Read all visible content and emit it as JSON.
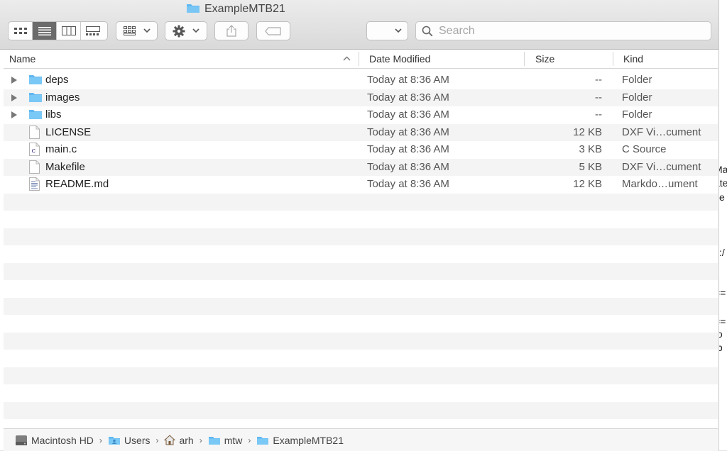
{
  "window": {
    "title": "ExampleMTB21"
  },
  "toolbar": {
    "view_modes": [
      "icon-view",
      "list-view",
      "column-view",
      "gallery-view"
    ],
    "active_view": "list-view",
    "search_placeholder": "Search"
  },
  "columns": {
    "name": "Name",
    "date": "Date Modified",
    "size": "Size",
    "kind": "Kind"
  },
  "files": [
    {
      "name": "deps",
      "date": "Today at 8:36 AM",
      "size": "--",
      "kind": "Folder",
      "type": "folder",
      "expandable": true
    },
    {
      "name": "images",
      "date": "Today at 8:36 AM",
      "size": "--",
      "kind": "Folder",
      "type": "folder",
      "expandable": true
    },
    {
      "name": "libs",
      "date": "Today at 8:36 AM",
      "size": "--",
      "kind": "Folder",
      "type": "folder",
      "expandable": true
    },
    {
      "name": "LICENSE",
      "date": "Today at 8:36 AM",
      "size": "12 KB",
      "kind": "DXF Vi…cument",
      "type": "document",
      "expandable": false
    },
    {
      "name": "main.c",
      "date": "Today at 8:36 AM",
      "size": "3 KB",
      "kind": "C Source",
      "type": "c-source",
      "expandable": false
    },
    {
      "name": "Makefile",
      "date": "Today at 8:36 AM",
      "size": "5 KB",
      "kind": "DXF Vi…cument",
      "type": "document",
      "expandable": false
    },
    {
      "name": "README.md",
      "date": "Today at 8:36 AM",
      "size": "12 KB",
      "kind": "Markdo…ument",
      "type": "text",
      "expandable": false
    }
  ],
  "pathbar": [
    {
      "label": "Macintosh HD",
      "icon": "hard-drive-icon"
    },
    {
      "label": "Users",
      "icon": "users-folder-icon"
    },
    {
      "label": "arh",
      "icon": "home-icon"
    },
    {
      "label": "mtw",
      "icon": "folder-icon"
    },
    {
      "label": "ExampleMTB21",
      "icon": "folder-icon"
    }
  ],
  "background_fragments": [
    "Ma",
    "ate",
    "se",
    "s:/",
    "==",
    "==",
    "to",
    "tb"
  ],
  "colors": {
    "folder": "#5fb7f0",
    "active_segment": "#6b6b6b",
    "row_stripe": "#f4f4f4"
  }
}
